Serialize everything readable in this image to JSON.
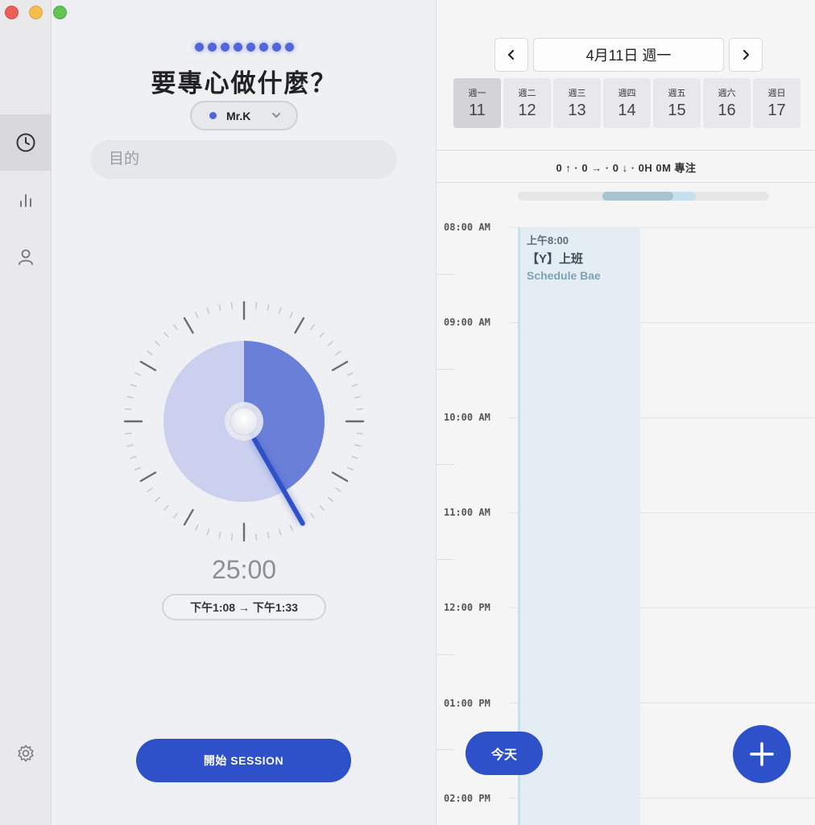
{
  "focus": {
    "title": "要專心做什麼？",
    "project": "Mr.K",
    "purpose_placeholder": "目的",
    "time_left": "25:00",
    "time_range": "下午1:08 → 下午1:33",
    "start_label": "開始 SESSION",
    "progress_fraction": 0.417
  },
  "sidebar": {
    "items": [
      {
        "icon": "clock-icon",
        "active": true
      },
      {
        "icon": "bar-chart-icon",
        "active": false
      },
      {
        "icon": "person-icon",
        "active": false
      },
      {
        "icon": "gear-icon",
        "active": false
      }
    ]
  },
  "calendar": {
    "date_label": "4月11日 週一",
    "prev": "‹",
    "next": "›",
    "days": [
      {
        "name": "週一",
        "num": "11",
        "selected": true
      },
      {
        "name": "週二",
        "num": "12",
        "selected": false
      },
      {
        "name": "週三",
        "num": "13",
        "selected": false
      },
      {
        "name": "週四",
        "num": "14",
        "selected": false
      },
      {
        "name": "週五",
        "num": "15",
        "selected": false
      },
      {
        "name": "週六",
        "num": "16",
        "selected": false
      },
      {
        "name": "週日",
        "num": "17",
        "selected": false
      }
    ],
    "summary": "0 ↑ · 0 → · 0 ↓ · 0H 0M 專注",
    "hours": [
      "08:00 AM",
      "09:00 AM",
      "10:00 AM",
      "11:00 AM",
      "12:00 PM",
      "01:00 PM",
      "02:00 PM"
    ],
    "event": {
      "time": "上午8:00",
      "title": "【Y】上班",
      "subtitle": "Schedule Bae"
    },
    "today_label": "今天"
  },
  "colors": {
    "accent": "#2e51c9",
    "dial_fill": "#6a7fd8",
    "dial_bg": "#cbd0ee",
    "event_bg": "#e3edf3"
  }
}
